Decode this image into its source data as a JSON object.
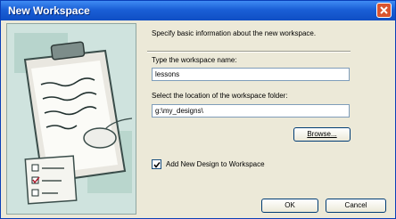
{
  "window": {
    "title": "New Workspace"
  },
  "icons": {
    "close": "close-icon",
    "art": "clipboard-icon",
    "check": "checkmark-icon"
  },
  "colors": {
    "titlebar": "#1a5fd6",
    "close_button": "#d9542f",
    "dialog": "#ece9d8"
  },
  "dialog": {
    "intro": "Specify basic information about the new workspace.",
    "name_label": "Type the workspace name:",
    "name_value": "lessons",
    "location_label": "Select the location of the workspace folder:",
    "location_value": "g:\\my_designs\\",
    "browse_label": "Browse...",
    "checkbox_label": "Add New Design to Workspace",
    "checkbox_checked": true,
    "ok_label": "OK",
    "cancel_label": "Cancel"
  }
}
